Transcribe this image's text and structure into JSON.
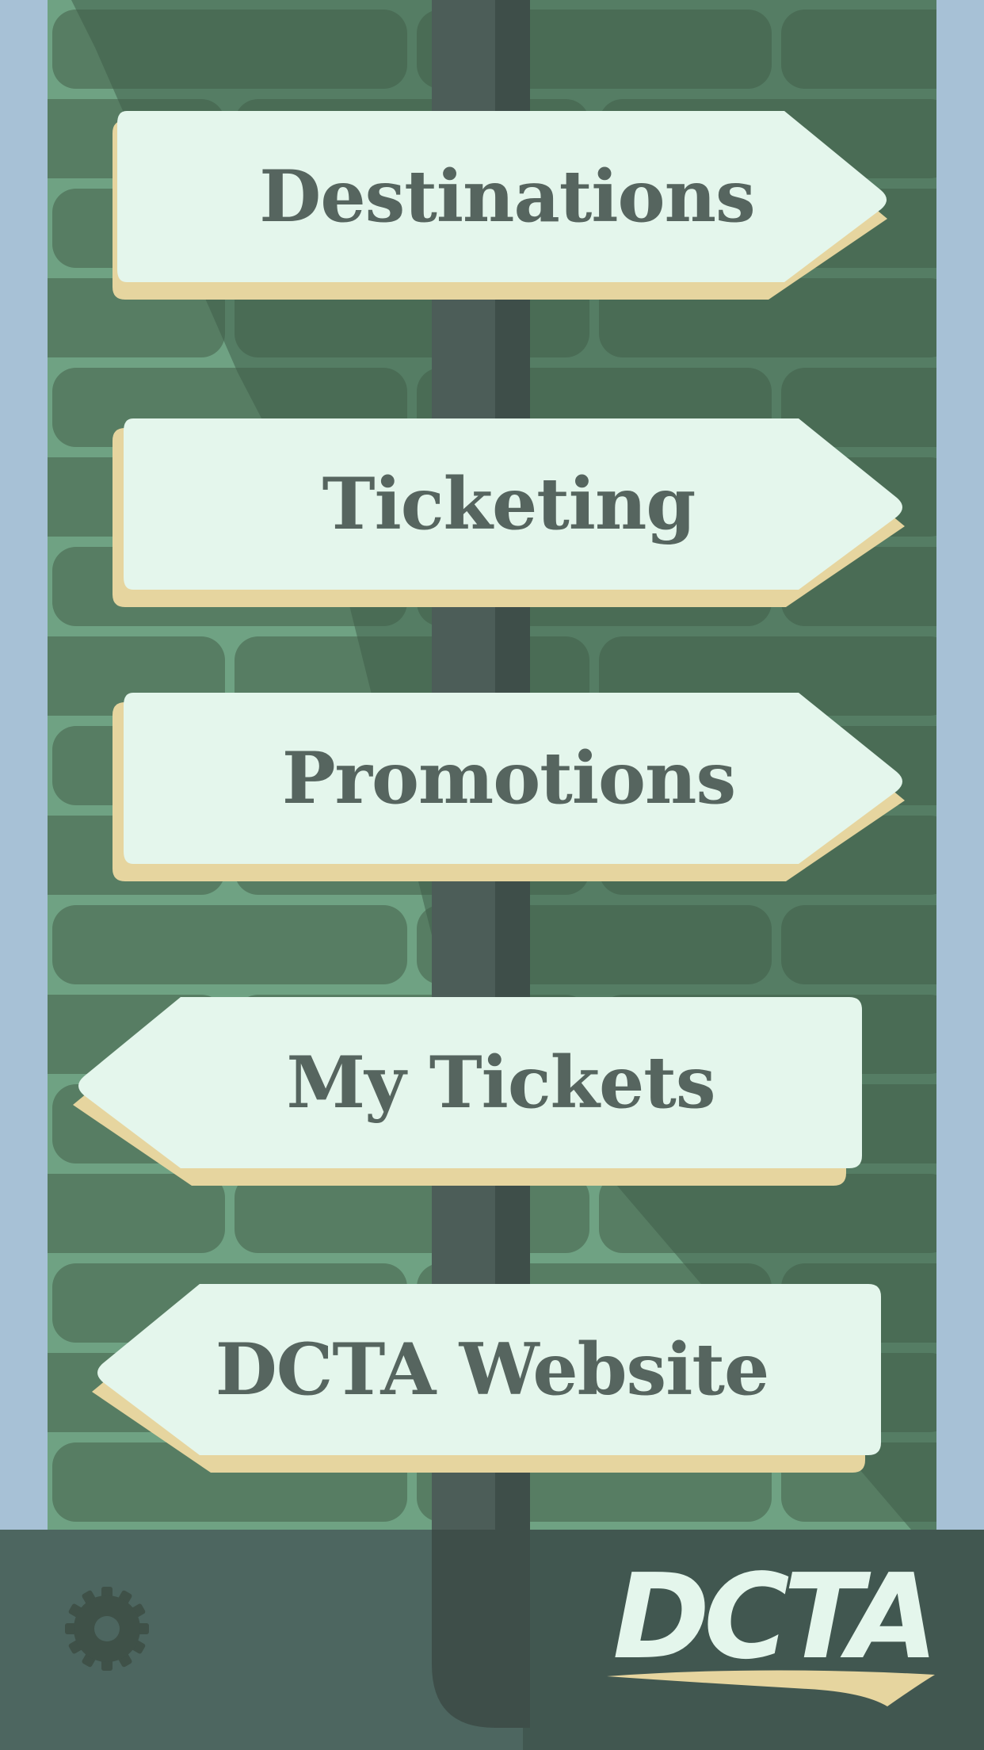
{
  "colors": {
    "sky": "#a7c1d6",
    "wall_light": "#5b8168",
    "wall_dark": "#415f4b",
    "mortar": "#6fa283",
    "post": "#3e4e49",
    "sign_face": "#e4f6ec",
    "sign_shadow": "#e6d59f",
    "sign_text": "#56655f",
    "ground": "#415750",
    "logo": "#e4f6ec",
    "logo_swoosh": "#e6d59f"
  },
  "menu": {
    "destinations": "Destinations",
    "ticketing": "Ticketing",
    "promotions": "Promotions",
    "my_tickets": "My Tickets",
    "website": "DCTA Website"
  },
  "footer": {
    "logo_text": "DCTA",
    "settings_icon": "gear-icon"
  }
}
